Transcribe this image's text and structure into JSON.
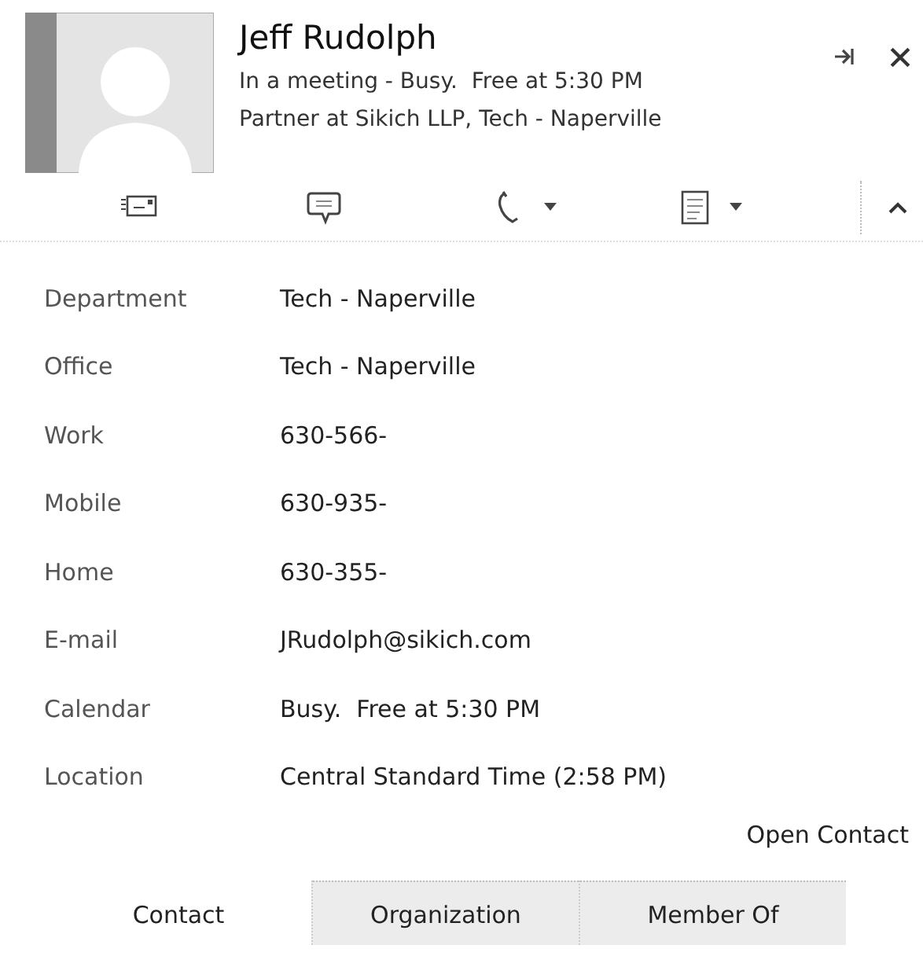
{
  "contact": {
    "name": "Jeff Rudolph",
    "status": "In a meeting - Busy.  Free at 5:30 PM",
    "title": "Partner at Sikich LLP, Tech - Naperville"
  },
  "toolbar": [
    {
      "kind": "email",
      "dropdown": false
    },
    {
      "kind": "chat",
      "dropdown": false
    },
    {
      "kind": "phone",
      "dropdown": true
    },
    {
      "kind": "list",
      "dropdown": true
    }
  ],
  "fields": [
    {
      "label": "Department",
      "value": "Tech - Naperville"
    },
    {
      "label": "Office",
      "value": "Tech - Naperville"
    },
    {
      "label": "Work",
      "value": "630-566-"
    },
    {
      "label": "Mobile",
      "value": "630-935-"
    },
    {
      "label": "Home",
      "value": "630-355-"
    },
    {
      "label": "E-mail",
      "value": "JRudolph@sikich.com"
    },
    {
      "label": "Calendar",
      "value": "Busy.  Free at 5:30 PM"
    },
    {
      "label": "Location",
      "value": "Central Standard Time (2:58 PM)"
    }
  ],
  "open_contact": "Open Contact",
  "tabs": [
    {
      "label": "Contact",
      "selected": true
    },
    {
      "label": "Organization",
      "selected": false
    },
    {
      "label": "Member Of",
      "selected": false
    }
  ]
}
